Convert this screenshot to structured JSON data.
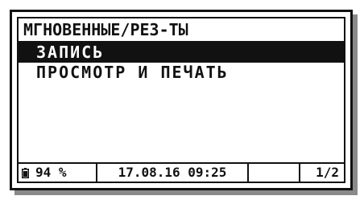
{
  "screen": {
    "title": "МГНОВЕННЫЕ/РЕЗ-ТЫ"
  },
  "menu": {
    "items": [
      {
        "label": "ЗАПИСЬ",
        "selected": true
      },
      {
        "label": "ПРОСМОТР И ПЕЧАТЬ",
        "selected": false
      }
    ]
  },
  "status_bar": {
    "battery_icon": "battery-icon",
    "battery_percent": "94 %",
    "datetime": "17.08.16 09:25",
    "page": "1/2"
  }
}
